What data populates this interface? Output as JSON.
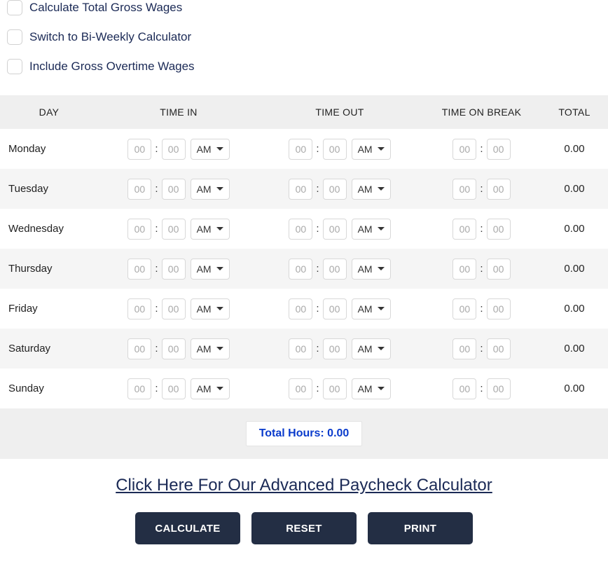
{
  "options": {
    "calc_gross": "Calculate Total Gross Wages",
    "switch_biweekly": "Switch to Bi-Weekly Calculator",
    "include_overtime": "Include Gross Overtime Wages"
  },
  "headers": {
    "day": "DAY",
    "time_in": "TIME IN",
    "time_out": "TIME OUT",
    "break": "TIME ON BREAK",
    "total": "TOTAL"
  },
  "placeholder": "00",
  "ampm_default": "AM",
  "days": [
    {
      "name": "Monday",
      "total": "0.00"
    },
    {
      "name": "Tuesday",
      "total": "0.00"
    },
    {
      "name": "Wednesday",
      "total": "0.00"
    },
    {
      "name": "Thursday",
      "total": "0.00"
    },
    {
      "name": "Friday",
      "total": "0.00"
    },
    {
      "name": "Saturday",
      "total": "0.00"
    },
    {
      "name": "Sunday",
      "total": "0.00"
    }
  ],
  "summary": {
    "total_hours_label": "Total Hours: ",
    "total_hours_value": "0.00"
  },
  "advanced_link": "Click Here For Our Advanced Paycheck Calculator",
  "buttons": {
    "calculate": "CALCULATE",
    "reset": "RESET",
    "print": "PRINT"
  }
}
